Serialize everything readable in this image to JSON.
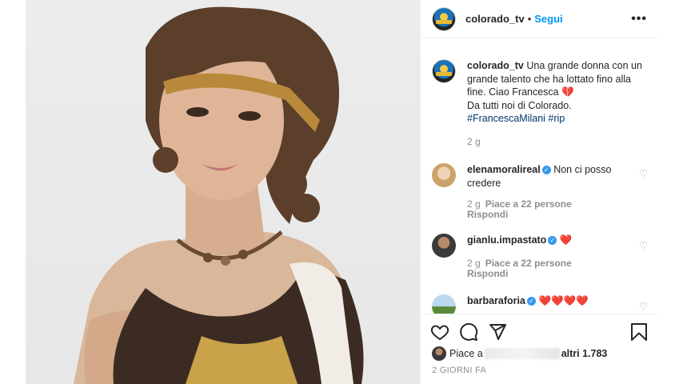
{
  "header": {
    "username": "colorado_tv",
    "separator": "•",
    "follow_label": "Segui",
    "more_icon": "more-horizontal-icon"
  },
  "caption": {
    "username": "colorado_tv",
    "text": "Una grande donna con un grande talento che ha lottato fino alla fine. Ciao Francesca",
    "emoji": "💔",
    "line2": "Da tutti noi di Colorado.",
    "hashtags": "#FrancescaMilani #rip",
    "time": "2 g"
  },
  "comments": [
    {
      "username": "elenamoralireal",
      "text": "Non ci posso credere",
      "time": "2 g",
      "likes": "Piace a 22 persone",
      "reply": "Rispondi"
    },
    {
      "username": "gianlu.impastato",
      "text": "❤️",
      "time": "2 g",
      "likes": "Piace a 22 persone",
      "reply": "Rispondi"
    },
    {
      "username": "barbaraforia",
      "text": "❤️❤️❤️❤️"
    }
  ],
  "likes": {
    "prefix": "Piace a",
    "suffix": "altri 1.783"
  },
  "date": "2 GIORNI FA",
  "icons": [
    "heart-icon",
    "comment-icon",
    "share-icon",
    "bookmark-icon",
    "verified-icon"
  ],
  "colors": {
    "link": "#0095f6",
    "hashtag": "#00376b",
    "muted": "#8e8e8e",
    "verified": "#3897f0"
  }
}
